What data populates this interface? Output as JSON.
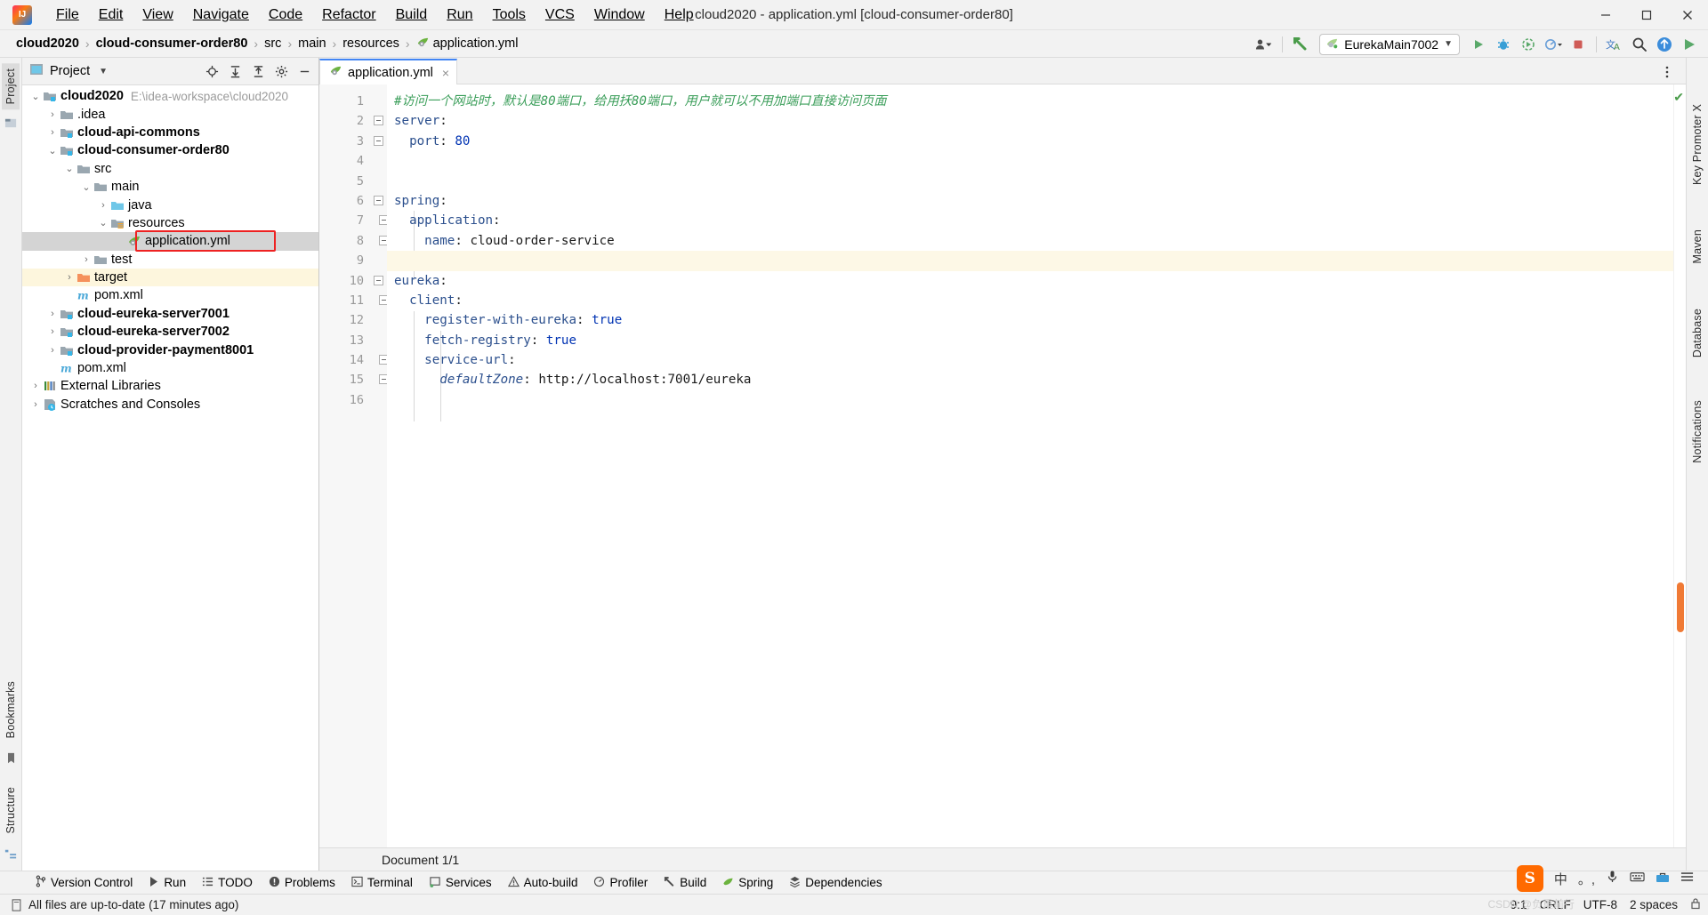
{
  "window": {
    "title": "cloud2020 - application.yml [cloud-consumer-order80]",
    "logo_text": "IJ",
    "minimize": "minimize-icon",
    "maximize": "maximize-icon",
    "close": "close-icon"
  },
  "menu": {
    "items": [
      {
        "label": "File"
      },
      {
        "label": "Edit"
      },
      {
        "label": "View"
      },
      {
        "label": "Navigate"
      },
      {
        "label": "Code"
      },
      {
        "label": "Refactor"
      },
      {
        "label": "Build"
      },
      {
        "label": "Run"
      },
      {
        "label": "Tools"
      },
      {
        "label": "VCS"
      },
      {
        "label": "Window"
      },
      {
        "label": "Help"
      }
    ]
  },
  "breadcrumb": {
    "items": [
      {
        "label": "cloud2020",
        "bold": true
      },
      {
        "label": "cloud-consumer-order80",
        "bold": true
      },
      {
        "label": "src",
        "bold": false
      },
      {
        "label": "main",
        "bold": false
      },
      {
        "label": "resources",
        "bold": false
      },
      {
        "label": "application.yml",
        "bold": false,
        "icon": "yml-file-icon"
      }
    ],
    "separator": "›"
  },
  "toolbar": {
    "avatar_label": "user-dropdown",
    "hammer_label": "build-project-button",
    "run_config": "EurekaMain7002",
    "run_label": "run-button",
    "debug_label": "debug-button",
    "coverage_label": "run-with-coverage-button",
    "profile_label": "profiler-dropdown",
    "stop_label": "stop-button",
    "translate_label": "translate-button",
    "search_label": "search-everywhere-button",
    "updates_label": "updates-button",
    "ide_run_label": "ide-run-button"
  },
  "project_panel": {
    "title": "Project",
    "dropdown": "chevron-down-icon",
    "actions": [
      {
        "name": "select-opened-file-icon",
        "label": "⊕"
      },
      {
        "name": "expand-all-icon",
        "label": "⤓"
      },
      {
        "name": "collapse-all-icon",
        "label": "⤒"
      },
      {
        "name": "settings-gear-icon",
        "label": "⚙"
      },
      {
        "name": "hide-panel-icon",
        "label": "—"
      }
    ],
    "tree": [
      {
        "depth": 0,
        "arrow": "down",
        "icon": "module-icon",
        "label": "cloud2020",
        "bold": true,
        "path": "E:\\idea-workspace\\cloud2020",
        "state": "normal"
      },
      {
        "depth": 1,
        "arrow": "right",
        "icon": "folder-icon",
        "label": ".idea",
        "bold": false,
        "state": "normal"
      },
      {
        "depth": 1,
        "arrow": "right",
        "icon": "module-icon",
        "label": "cloud-api-commons",
        "bold": true,
        "state": "normal"
      },
      {
        "depth": 1,
        "arrow": "down",
        "icon": "module-icon",
        "label": "cloud-consumer-order80",
        "bold": true,
        "state": "normal"
      },
      {
        "depth": 2,
        "arrow": "down",
        "icon": "folder-icon",
        "label": "src",
        "bold": false,
        "state": "normal"
      },
      {
        "depth": 3,
        "arrow": "down",
        "icon": "folder-icon",
        "label": "main",
        "bold": false,
        "state": "normal"
      },
      {
        "depth": 4,
        "arrow": "right",
        "icon": "source-root-icon",
        "label": "java",
        "bold": false,
        "state": "normal"
      },
      {
        "depth": 4,
        "arrow": "down",
        "icon": "resource-root-icon",
        "label": "resources",
        "bold": false,
        "state": "normal"
      },
      {
        "depth": 5,
        "arrow": "none",
        "icon": "yml-file-icon",
        "label": "application.yml",
        "bold": false,
        "state": "selected"
      },
      {
        "depth": 3,
        "arrow": "right",
        "icon": "folder-icon",
        "label": "test",
        "bold": false,
        "state": "normal"
      },
      {
        "depth": 2,
        "arrow": "right",
        "icon": "excluded-folder-icon",
        "label": "target",
        "bold": false,
        "state": "highlight"
      },
      {
        "depth": 2,
        "arrow": "none",
        "icon": "maven-pom-icon",
        "label": "pom.xml",
        "bold": false,
        "state": "normal"
      },
      {
        "depth": 1,
        "arrow": "right",
        "icon": "module-icon",
        "label": "cloud-eureka-server7001",
        "bold": true,
        "state": "normal"
      },
      {
        "depth": 1,
        "arrow": "right",
        "icon": "module-icon",
        "label": "cloud-eureka-server7002",
        "bold": true,
        "state": "normal"
      },
      {
        "depth": 1,
        "arrow": "right",
        "icon": "module-icon",
        "label": "cloud-provider-payment8001",
        "bold": true,
        "state": "normal"
      },
      {
        "depth": 1,
        "arrow": "none",
        "icon": "maven-pom-icon",
        "label": "pom.xml",
        "bold": false,
        "state": "normal"
      },
      {
        "depth": 0,
        "arrow": "right",
        "icon": "external-libraries-icon",
        "label": "External Libraries",
        "bold": false,
        "state": "normal"
      },
      {
        "depth": 0,
        "arrow": "right",
        "icon": "scratches-icon",
        "label": "Scratches and Consoles",
        "bold": false,
        "state": "normal"
      }
    ]
  },
  "editor": {
    "tab": {
      "label": "application.yml",
      "icon": "yml-file-icon",
      "close": "×"
    },
    "more_icon": "more-vertical-icon",
    "inspection_ok": "✔",
    "lines": [
      {
        "no": 1,
        "fold": "none",
        "current": false,
        "tokens": [
          {
            "t": "#访问一个网站时，默认是80端口，给用扷80端口，用户就可以不用加端口直接访问页面",
            "c": "cm"
          }
        ]
      },
      {
        "no": 2,
        "fold": "open",
        "current": false,
        "tokens": [
          {
            "t": "server",
            "c": "k"
          },
          {
            "t": ":",
            "c": "s"
          }
        ]
      },
      {
        "no": 3,
        "fold": "end",
        "current": false,
        "tokens": [
          {
            "t": "  port",
            "c": "k"
          },
          {
            "t": ": ",
            "c": "s"
          },
          {
            "t": "80",
            "c": "v"
          }
        ]
      },
      {
        "no": 4,
        "fold": "none",
        "current": false,
        "tokens": []
      },
      {
        "no": 5,
        "fold": "none",
        "current": false,
        "tokens": []
      },
      {
        "no": 6,
        "fold": "open",
        "current": false,
        "tokens": [
          {
            "t": "spring",
            "c": "k"
          },
          {
            "t": ":",
            "c": "s"
          }
        ]
      },
      {
        "no": 7,
        "fold": "open",
        "current": false,
        "tokens": [
          {
            "t": "  application",
            "c": "k"
          },
          {
            "t": ":",
            "c": "s"
          }
        ]
      },
      {
        "no": 8,
        "fold": "end",
        "current": false,
        "tokens": [
          {
            "t": "    name",
            "c": "k"
          },
          {
            "t": ": ",
            "c": "s"
          },
          {
            "t": "cloud-order-service",
            "c": "s"
          }
        ]
      },
      {
        "no": 9,
        "fold": "none",
        "current": true,
        "tokens": []
      },
      {
        "no": 10,
        "fold": "open",
        "current": false,
        "tokens": [
          {
            "t": "eureka",
            "c": "k"
          },
          {
            "t": ":",
            "c": "s"
          }
        ]
      },
      {
        "no": 11,
        "fold": "open",
        "current": false,
        "tokens": [
          {
            "t": "  client",
            "c": "k"
          },
          {
            "t": ":",
            "c": "s"
          }
        ]
      },
      {
        "no": 12,
        "fold": "none",
        "current": false,
        "tokens": [
          {
            "t": "    register-with-eureka",
            "c": "k"
          },
          {
            "t": ": ",
            "c": "s"
          },
          {
            "t": "true",
            "c": "v"
          }
        ]
      },
      {
        "no": 13,
        "fold": "none",
        "current": false,
        "tokens": [
          {
            "t": "    fetch-registry",
            "c": "k"
          },
          {
            "t": ": ",
            "c": "s"
          },
          {
            "t": "true",
            "c": "v"
          }
        ]
      },
      {
        "no": 14,
        "fold": "open",
        "current": false,
        "tokens": [
          {
            "t": "    service-url",
            "c": "k"
          },
          {
            "t": ":",
            "c": "s"
          }
        ]
      },
      {
        "no": 15,
        "fold": "end",
        "current": false,
        "tokens": [
          {
            "t": "      defaultZone",
            "c": "it"
          },
          {
            "t": ": ",
            "c": "s"
          },
          {
            "t": "http://localhost:7001/eureka",
            "c": "s"
          }
        ]
      },
      {
        "no": 16,
        "fold": "none",
        "current": false,
        "tokens": []
      }
    ],
    "status": {
      "document": "Document 1/1"
    }
  },
  "left_strip": {
    "top": [
      {
        "label": "Project",
        "active": true
      }
    ],
    "bottom": [
      {
        "label": "Bookmarks",
        "active": false
      },
      {
        "label": "Structure",
        "active": false
      }
    ]
  },
  "right_strip": {
    "items": [
      {
        "label": "Key Promoter X"
      },
      {
        "label": "Maven"
      },
      {
        "label": "Database"
      },
      {
        "label": "Notifications"
      }
    ]
  },
  "bottom_bar": {
    "items": [
      {
        "label": "Version Control",
        "icon": "branch-icon"
      },
      {
        "label": "Run",
        "icon": "play-icon"
      },
      {
        "label": "TODO",
        "icon": "todo-icon"
      },
      {
        "label": "Problems",
        "icon": "problems-icon"
      },
      {
        "label": "Terminal",
        "icon": "terminal-icon"
      },
      {
        "label": "Services",
        "icon": "services-icon"
      },
      {
        "label": "Auto-build",
        "icon": "warning-icon"
      },
      {
        "label": "Profiler",
        "icon": "profiler-icon"
      },
      {
        "label": "Build",
        "icon": "hammer-icon"
      },
      {
        "label": "Spring",
        "icon": "spring-leaf-icon"
      },
      {
        "label": "Dependencies",
        "icon": "dependencies-icon"
      }
    ]
  },
  "status_bar": {
    "message": "All files are up-to-date (17 minutes ago)",
    "message_icon": "document-icon",
    "caret": "9:1",
    "line_separator": "CRLF",
    "encoding": "UTF-8",
    "indent": "2 spaces",
    "lock_icon": "lock-icon"
  },
  "ime": {
    "logo": "S",
    "mode": "中",
    "punctuation": "。,",
    "mic": "mic-icon",
    "keyboard": "keyboard-icon",
    "toolbox": "toolbox-icon",
    "menu": "menu-icon"
  },
  "watermark": "CSDN @负重前行",
  "colors": {
    "accent_blue": "#4285f4",
    "comment_green": "#3b9e5a",
    "key_blue": "#2b4f8d",
    "value_blue": "#0033b3",
    "selection_gray": "#d4d4d4",
    "highlight_yellow": "#fdf6dd",
    "red_box": "#ee2222",
    "orange": "#f07a35"
  }
}
